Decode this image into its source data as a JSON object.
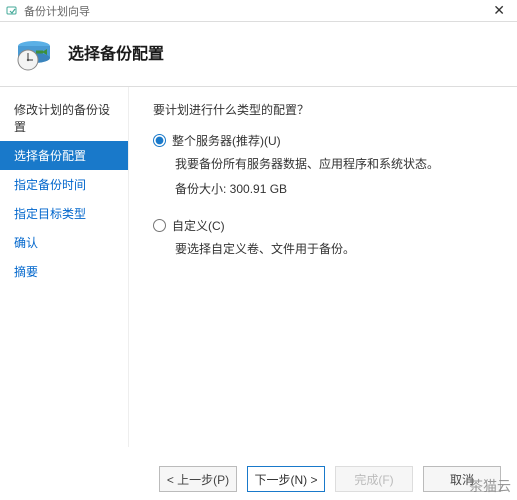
{
  "titlebar": {
    "title": "备份计划向导"
  },
  "header": {
    "title": "选择备份配置"
  },
  "sidebar": {
    "items": [
      {
        "label": "修改计划的备份设置"
      },
      {
        "label": "选择备份配置"
      },
      {
        "label": "指定备份时间"
      },
      {
        "label": "指定目标类型"
      },
      {
        "label": "确认"
      },
      {
        "label": "摘要"
      }
    ]
  },
  "content": {
    "prompt": "要计划进行什么类型的配置？",
    "options": [
      {
        "label": "整个服务器(推荐)(U)",
        "desc1": "我要备份所有服务器数据、应用程序和系统状态。",
        "desc2": "备份大小: 300.91 GB"
      },
      {
        "label": "自定义(C)",
        "desc1": "要选择自定义卷、文件用于备份。"
      }
    ]
  },
  "footer": {
    "prev": "< 上一步(P)",
    "next": "下一步(N) >",
    "finish": "完成(F)",
    "cancel": "取消"
  },
  "watermark": "茶猫云"
}
